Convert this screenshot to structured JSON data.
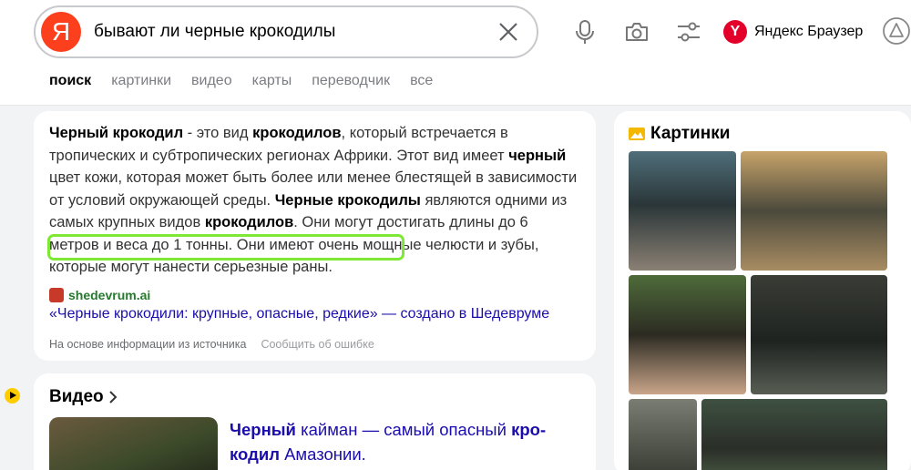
{
  "search": {
    "logo": "Я",
    "query": "бывают ли черные крокодилы"
  },
  "header": {
    "brand_mark": "Y",
    "brand_label": "Яндекс Браузер"
  },
  "tabs": [
    {
      "label": "поиск",
      "active": true
    },
    {
      "label": "картинки",
      "active": false
    },
    {
      "label": "видео",
      "active": false
    },
    {
      "label": "карты",
      "active": false
    },
    {
      "label": "переводчик",
      "active": false
    },
    {
      "label": "все",
      "active": false
    }
  ],
  "answer": {
    "t1": "Черный крокодил",
    "t2": " - это вид ",
    "t3": "крокодилов",
    "t4": ", который встречается в тропических и субтропических регионах Африки. Этот вид имеет ",
    "t5": "черный",
    "t6": " цвет кожи, которая может быть более или менее блестящей в зависимости от условий окружающей среды. ",
    "t7": "Черные крокодилы",
    "t8": " являются одними из самых крупных видов ",
    "t9": "крокодилов",
    "t10": ". Они могут достигать длины до 6 метров и веса до 1 тонны. Они имеют очень мощные челюсти и зубы, которые могут нанести серьезные раны.",
    "source_name": "shedevrum.ai",
    "source_title": "«Черные крокодили: крупные, опасные, редкие» — создано в Шедевруме",
    "footer_note": "На основе информации из источника",
    "report_error": "Сообщить об ошибке"
  },
  "video": {
    "heading": "Видео",
    "caption_b1": "Черный",
    "caption_t1": " кайман — самый опасный ",
    "caption_b2": "кро-\nкодил",
    "caption_t2": " Амазонии."
  },
  "images": {
    "heading": "Картинки"
  },
  "colors": {
    "accent_red": "#fc3f1d",
    "link": "#1a0dab",
    "source_green": "#247a2c",
    "highlight": "#7ee834"
  }
}
